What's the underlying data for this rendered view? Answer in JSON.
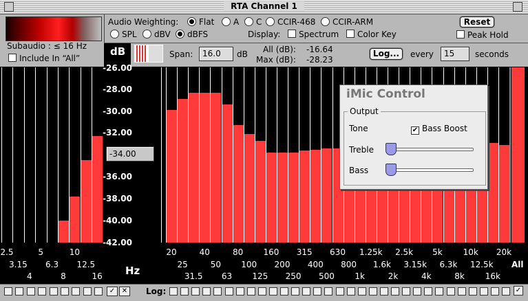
{
  "window": {
    "title": "RTA Channel 1"
  },
  "left_panel": {
    "subaudio": "Subaudio : ≤ 16 Hz",
    "include_all": "Include In “All”"
  },
  "weighting": {
    "label": "Audio Weighting:",
    "options": [
      "Flat",
      "A",
      "C",
      "CCIR-468",
      "CCIR-ARM"
    ],
    "selected": "Flat"
  },
  "units": {
    "options": [
      "SPL",
      "dBV",
      "dBFS"
    ],
    "selected": "dBFS"
  },
  "display": {
    "label": "Display:",
    "spectrum": "Spectrum",
    "color_key": "Color Key",
    "spectrum_checked": false,
    "color_key_checked": false
  },
  "reset": {
    "label": "Reset",
    "peak_hold": "Peak Hold",
    "peak_hold_checked": false
  },
  "info_bar": {
    "db_label": "dB",
    "span_label": "Span:",
    "span_value": "16.0",
    "span_unit": "dB",
    "all_label": "All (dB):",
    "all_value": "-16.64",
    "max_label": "Max (dB):",
    "max_value": "-28.23",
    "log_button": "Log...",
    "every_label": "every",
    "every_value": "15",
    "seconds_label": "seconds"
  },
  "y_axis": {
    "ticks": [
      "-26.00",
      "-28.00",
      "-30.00",
      "-32.00",
      "-34.00",
      "-36.00",
      "-38.00",
      "-40.00",
      "-42.00"
    ],
    "cursor_value": "-34.00"
  },
  "hz_label": "Hz",
  "all_label": "All",
  "chart_data": {
    "type": "bar",
    "ylim": [
      -42,
      -26
    ],
    "subaudio": {
      "categories": [
        "2.5",
        "3.15",
        "4",
        "5",
        "6.3",
        "8",
        "10",
        "12.5",
        "16"
      ],
      "values": [
        -42,
        -42,
        -42,
        -42,
        -42,
        -40.0,
        -37.8,
        -34.5,
        -32.3
      ]
    },
    "main": {
      "categories": [
        "20",
        "25",
        "31.5",
        "40",
        "50",
        "63",
        "80",
        "100",
        "125",
        "160",
        "200",
        "250",
        "315",
        "400",
        "500",
        "630",
        "800",
        "1k",
        "1.25k",
        "1.6k",
        "2k",
        "2.5k",
        "3.15k",
        "4k",
        "5k",
        "6.3k",
        "8k",
        "10k",
        "12.5k",
        "16k",
        "20k"
      ],
      "values": [
        -29.9,
        -28.9,
        -28.3,
        -28.3,
        -28.3,
        -29.4,
        -31.3,
        -32.1,
        -32.7,
        -33.8,
        -33.8,
        -33.8,
        -33.6,
        -33.5,
        -33.4,
        -33.4,
        -33.3,
        -33.3,
        -33.2,
        -33.2,
        -33.2,
        -33.2,
        -33.2,
        -33.2,
        -33.2,
        -33.1,
        -33.1,
        -33.0,
        -32.9,
        -32.9,
        -33.1
      ]
    },
    "all_value": -16.64
  },
  "x_labels": {
    "sub_row1": [
      "2.5",
      "5",
      "10"
    ],
    "sub_row2": [
      "3.15",
      "6.3",
      "12.5"
    ],
    "sub_row3": [
      "4",
      "8",
      "16"
    ],
    "main_row1": [
      "20",
      "40",
      "80",
      "160",
      "315",
      "630",
      "1.25k",
      "2.5k",
      "5k",
      "10k",
      "20k"
    ],
    "main_row2": [
      "25",
      "50",
      "100",
      "200",
      "400",
      "800",
      "1.6k",
      "3.15k",
      "6.3k",
      "12.5k"
    ],
    "main_row3": [
      "31.5",
      "63",
      "125",
      "250",
      "500",
      "1k",
      "2k",
      "4k",
      "8k",
      "16k"
    ]
  },
  "imic": {
    "title": "iMic Control",
    "output_label": "Output",
    "tone_label": "Tone",
    "bass_boost": "Bass Boost",
    "bass_boost_checked": true,
    "treble_label": "Treble",
    "bass_label": "Bass",
    "treble_level": 0.0,
    "bass_level": 0.0
  },
  "status": {
    "log_label": "Log:"
  },
  "colors": {
    "bar": "#ff3a3a",
    "background": "#000000",
    "panel": "#b8b8b8"
  }
}
